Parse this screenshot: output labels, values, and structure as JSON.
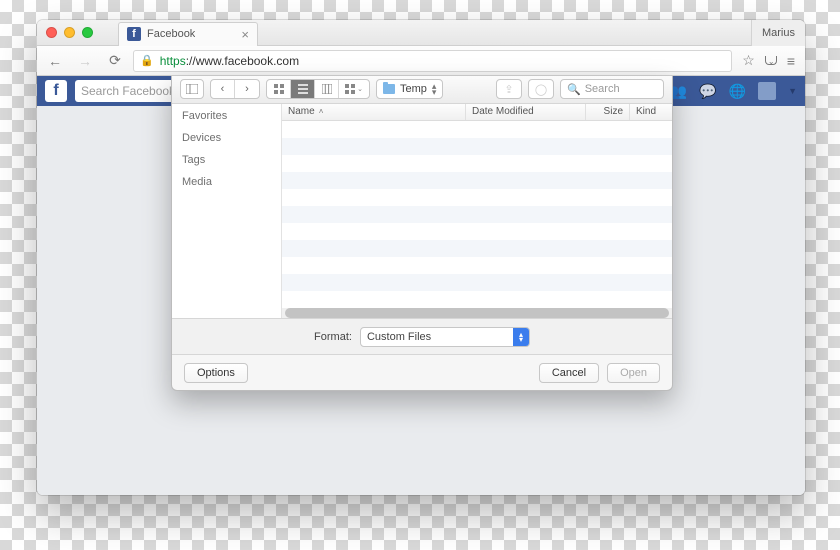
{
  "browser": {
    "tab_title": "Facebook",
    "profile": "Marius",
    "url_scheme": "https",
    "url_rest": "://www.facebook.com"
  },
  "facebook": {
    "search_placeholder": "Search Facebook"
  },
  "dialog": {
    "current_folder": "Temp",
    "search_placeholder": "Search",
    "sidebar": [
      "Favorites",
      "Devices",
      "Tags",
      "Media"
    ],
    "columns": [
      "Name",
      "Date Modified",
      "Size",
      "Kind"
    ],
    "format_label": "Format:",
    "format_value": "Custom Files",
    "buttons": {
      "options": "Options",
      "cancel": "Cancel",
      "open": "Open"
    }
  }
}
